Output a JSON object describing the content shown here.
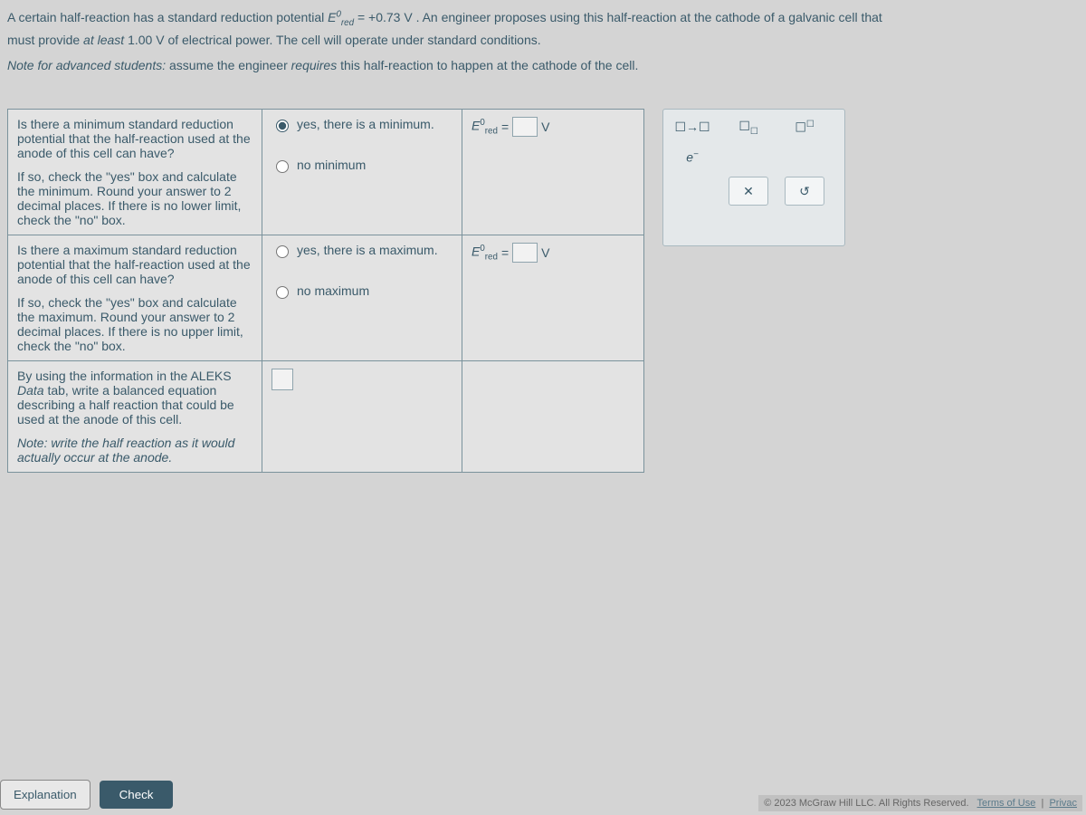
{
  "problem": {
    "line1a": "A certain half-reaction has a standard reduction potential ",
    "ered_symbol": "E",
    "ered_sup": "0",
    "ered_sub": "red",
    "value": "= +0.73 V",
    "line1b": ". An engineer proposes using this half-reaction at the cathode of a galvanic cell that",
    "line2": "must provide at least 1.00 V of electrical power. The cell will operate under standard conditions.",
    "note_prefix": "Note for advanced students:",
    "note_body": " assume the engineer requires this half-reaction to happen at the cathode of the cell."
  },
  "rows": [
    {
      "question1": "Is there a minimum standard reduction potential that the half-reaction used at the anode of this cell can have?",
      "question2": "If so, check the \"yes\" box and calculate the minimum. Round your answer to 2 decimal places. If there is no lower limit, check the \"no\" box.",
      "opt_yes": "yes, there is a minimum.",
      "opt_no": "no minimum",
      "unit": "V"
    },
    {
      "question1": "Is there a maximum standard reduction potential that the half-reaction used at the anode of this cell can have?",
      "question2": "If so, check the \"yes\" box and calculate the maximum. Round your answer to 2 decimal places. If there is no upper limit, check the \"no\" box.",
      "opt_yes": "yes, there is a maximum.",
      "opt_no": "no maximum",
      "unit": "V"
    },
    {
      "question1": "By using the information in the ALEKS Data tab, write a balanced equation describing a half reaction that could be used at the anode of this cell.",
      "question2": "Note: write the half reaction as it would actually occur at the anode."
    }
  ],
  "tools": {
    "arrow": "☐→☐",
    "sub_tool": "☐",
    "sub_tool_sub": "☐",
    "sup_tool": "☐",
    "sup_tool_sup": "☐",
    "electron": "e",
    "electron_sup": "−",
    "close": "✕",
    "reset": "↺"
  },
  "footer": {
    "explanation": "Explanation",
    "check": "Check",
    "copyright": "© 2023 McGraw Hill LLC. All Rights Reserved.",
    "terms": "Terms of Use",
    "privacy": "Privac"
  }
}
